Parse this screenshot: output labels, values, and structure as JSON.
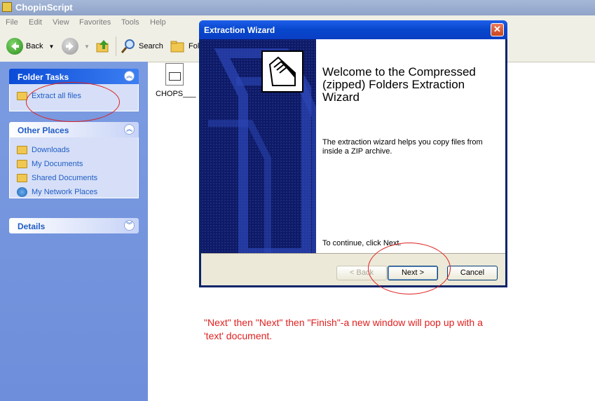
{
  "window": {
    "title": "ChopinScript"
  },
  "menu": [
    "File",
    "Edit",
    "View",
    "Favorites",
    "Tools",
    "Help"
  ],
  "toolbar": {
    "back_label": "Back",
    "search_label": "Search",
    "folders_label": "Fol"
  },
  "left_pane": {
    "folder_tasks": {
      "title": "Folder Tasks",
      "items": [
        "Extract all files"
      ]
    },
    "other_places": {
      "title": "Other Places",
      "items": [
        "Downloads",
        "My Documents",
        "Shared Documents",
        "My Network Places"
      ]
    },
    "details": {
      "title": "Details"
    }
  },
  "files": [
    {
      "name": "CHOPS___"
    }
  ],
  "dialog": {
    "title": "Extraction Wizard",
    "heading": "Welcome to the Compressed (zipped) Folders Extraction Wizard",
    "intro": "The extraction wizard helps you copy files from inside a ZIP archive.",
    "continue_text": "To continue, click Next.",
    "buttons": {
      "back": "< Back",
      "next": "Next >",
      "cancel": "Cancel"
    }
  },
  "annotation": "\"Next\" then \"Next\" then \"Finish\"-a new window will pop up with a 'text' document.",
  "colors": {
    "annotation": "#e02020",
    "taskpane": "#6e8edb",
    "dialog_title": "#0747cc"
  }
}
